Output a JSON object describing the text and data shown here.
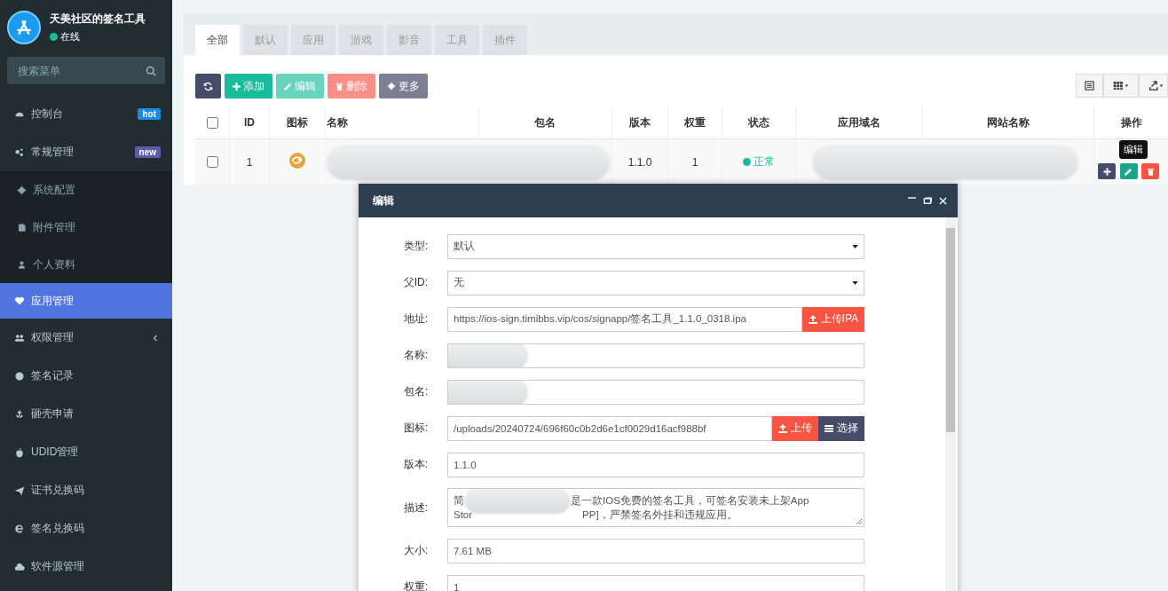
{
  "sidebar": {
    "title": "天美社区的签名工具",
    "status": {
      "text": "在线",
      "online": true
    },
    "search": {
      "placeholder": "搜索菜单"
    },
    "items": [
      {
        "label": "控制台",
        "badge": {
          "text": "hot",
          "color": "#1e88e5"
        },
        "selected": false
      },
      {
        "label": "常规管理",
        "badge": {
          "text": "new",
          "color": "#605ca8"
        },
        "selected": false,
        "expanded": true,
        "children": [
          {
            "label": "系统配置",
            "selected": false
          },
          {
            "label": "附件管理",
            "selected": false
          },
          {
            "label": "个人资料",
            "selected": false
          }
        ]
      },
      {
        "label": "应用管理",
        "selected": true
      },
      {
        "label": "权限管理",
        "selected": false,
        "expanded": false
      },
      {
        "label": "签名记录",
        "selected": false
      },
      {
        "label": "砸壳申请",
        "selected": false
      },
      {
        "label": "UDID管理",
        "selected": false
      },
      {
        "label": "证书兑换码",
        "selected": false
      },
      {
        "label": "签名兑换码",
        "selected": false
      },
      {
        "label": "软件源管理",
        "selected": false
      }
    ]
  },
  "tabs": [
    {
      "label": "全部",
      "selected": true
    },
    {
      "label": "默认",
      "selected": false
    },
    {
      "label": "应用",
      "selected": false
    },
    {
      "label": "游戏",
      "selected": false
    },
    {
      "label": "影音",
      "selected": false
    },
    {
      "label": "工具",
      "selected": false
    },
    {
      "label": "插件",
      "selected": false
    }
  ],
  "toolbar": [
    {
      "kind": "refresh",
      "disabled": false
    },
    {
      "kind": "add",
      "label": "添加",
      "disabled": false
    },
    {
      "kind": "edit",
      "label": "编辑",
      "disabled": true
    },
    {
      "kind": "delete",
      "label": "删除",
      "disabled": true
    },
    {
      "kind": "more",
      "label": "更多",
      "disabled": false
    }
  ],
  "table": {
    "select_all": {
      "checked": false
    },
    "columns": [
      "ID",
      "图标",
      "名称",
      "包名",
      "版本",
      "权重",
      "状态",
      "应用域名",
      "网站名称",
      "操作"
    ],
    "rows": [
      {
        "checked": false,
        "id": "1",
        "version": "1.1.0",
        "weight": "1",
        "status": {
          "text": "正常",
          "color": "#18bc9c"
        },
        "tooltip": "编辑"
      }
    ]
  },
  "dialog": {
    "title": "编辑",
    "fields": [
      {
        "kind": "select",
        "label": "类型:",
        "value": "默认"
      },
      {
        "kind": "select",
        "label": "父ID:",
        "value": "无"
      },
      {
        "kind": "text",
        "label": "地址:",
        "value": "https://ios-sign.timibbs.vip/cos/signapp/签名工具_1.1.0_0318.ipa",
        "buttons": [
          {
            "kind": "danger",
            "label": "上传IPA"
          }
        ]
      },
      {
        "kind": "hidden",
        "label": "名称:"
      },
      {
        "kind": "hidden",
        "label": "包名:"
      },
      {
        "kind": "text",
        "label": "图标:",
        "value": "/uploads/20240724/696f60c0b2d6e1cf0029d16acf988bf",
        "buttons": [
          {
            "kind": "danger",
            "label": "上传"
          },
          {
            "kind": "dark",
            "label": "选择"
          }
        ]
      },
      {
        "kind": "text",
        "label": "版本:",
        "value": "1.1.0"
      },
      {
        "kind": "textarea",
        "label": "描述:",
        "lines": [
          [
            "简",
            "是一款IOS免费的签名工具，可签名安装未上架App"
          ],
          [
            "Stor",
            "PP]，严禁签名外挂和违规应用。"
          ]
        ]
      },
      {
        "kind": "text",
        "label": "大小:",
        "value": "7.61 MB"
      },
      {
        "kind": "text",
        "label": "权重:",
        "value": "1"
      }
    ]
  }
}
